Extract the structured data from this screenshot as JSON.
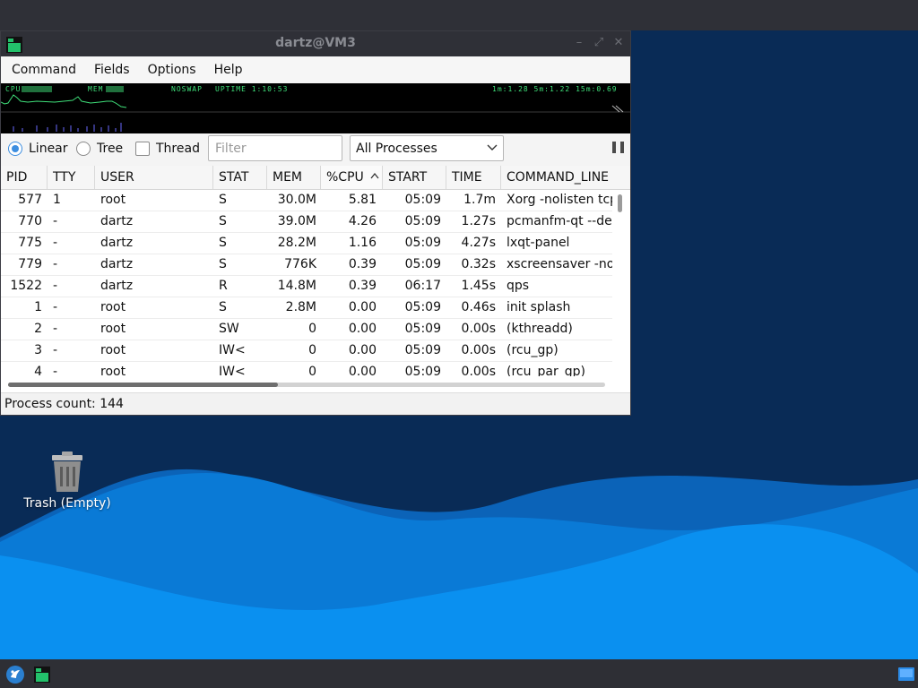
{
  "window": {
    "title": "dartz@VM3",
    "buttons": {
      "minimize": "–",
      "maximize": "⤢",
      "close": "✕"
    }
  },
  "menubar": {
    "items": [
      "Command",
      "Fields",
      "Options",
      "Help"
    ]
  },
  "graph": {
    "cpu_label": "CPU",
    "mem_label": "MEM",
    "swap_label": "NOSWAP",
    "uptime": "UPTIME 1:10:53",
    "load": "1m:1.28 5m:1.22 15m:0.69"
  },
  "toolbar": {
    "view_modes": [
      "Linear",
      "Tree"
    ],
    "selected_view": "Linear",
    "thread_label": "Thread",
    "thread_checked": false,
    "filter_placeholder": "Filter",
    "filter_value": "",
    "process_scope": "All Processes"
  },
  "table": {
    "columns": [
      "PID",
      "TTY",
      "USER",
      "STAT",
      "MEM",
      "%CPU",
      "START",
      "TIME",
      "COMMAND_LINE"
    ],
    "sorted_column": "%CPU",
    "rows": [
      {
        "pid": "577",
        "tty": "1",
        "user": "root",
        "stat": "S",
        "mem": "30.0M",
        "cpu": "5.81",
        "start": "05:09",
        "time": "1.7m",
        "cmd": "Xorg -nolisten tcp"
      },
      {
        "pid": "770",
        "tty": "-",
        "user": "dartz",
        "stat": "S",
        "mem": "39.0M",
        "cpu": "4.26",
        "start": "05:09",
        "time": "1.27s",
        "cmd": "pcmanfm-qt --desktop"
      },
      {
        "pid": "775",
        "tty": "-",
        "user": "dartz",
        "stat": "S",
        "mem": "28.2M",
        "cpu": "1.16",
        "start": "05:09",
        "time": "4.27s",
        "cmd": "lxqt-panel"
      },
      {
        "pid": "779",
        "tty": "-",
        "user": "dartz",
        "stat": "S",
        "mem": "776K",
        "cpu": "0.39",
        "start": "05:09",
        "time": "0.32s",
        "cmd": "xscreensaver -no-splash"
      },
      {
        "pid": "1522",
        "tty": "-",
        "user": "dartz",
        "stat": "R",
        "mem": "14.8M",
        "cpu": "0.39",
        "start": "06:17",
        "time": "1.45s",
        "cmd": "qps"
      },
      {
        "pid": "1",
        "tty": "-",
        "user": "root",
        "stat": "S",
        "mem": "2.8M",
        "cpu": "0.00",
        "start": "05:09",
        "time": "0.46s",
        "cmd": "init splash"
      },
      {
        "pid": "2",
        "tty": "-",
        "user": "root",
        "stat": "SW",
        "mem": "0",
        "cpu": "0.00",
        "start": "05:09",
        "time": "0.00s",
        "cmd": "(kthreadd)"
      },
      {
        "pid": "3",
        "tty": "-",
        "user": "root",
        "stat": "IW<",
        "mem": "0",
        "cpu": "0.00",
        "start": "05:09",
        "time": "0.00s",
        "cmd": "(rcu_gp)"
      },
      {
        "pid": "4",
        "tty": "-",
        "user": "root",
        "stat": "IW<",
        "mem": "0",
        "cpu": "0.00",
        "start": "05:09",
        "time": "0.00s",
        "cmd": "(rcu_par_gp)"
      }
    ]
  },
  "status": {
    "process_count": "Process count: 144"
  },
  "desktop": {
    "trash_label": "Trash (Empty)"
  },
  "colors": {
    "desktop_bg": "#092b56",
    "wave_back": "#0b6bc4",
    "wave_front": "#0a86e8",
    "graph_green": "#3fe07a",
    "graph_bg": "#000000",
    "accent": "#3d8ee0"
  }
}
